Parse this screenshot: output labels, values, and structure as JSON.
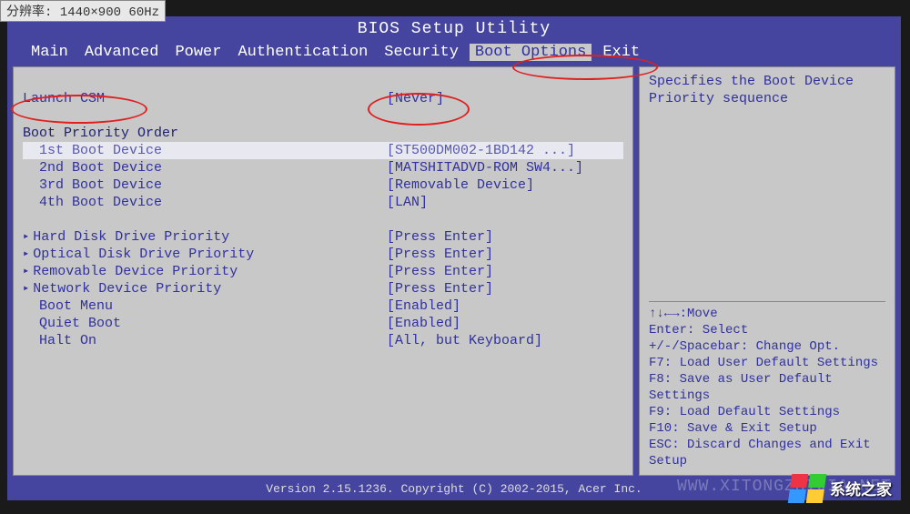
{
  "monitor_info": "分辨率: 1440×900 60Hz",
  "title": "BIOS Setup Utility",
  "menu": {
    "items": [
      {
        "label": "Main"
      },
      {
        "label": "Advanced"
      },
      {
        "label": "Power"
      },
      {
        "label": "Authentication"
      },
      {
        "label": "Security"
      },
      {
        "label": "Boot Options"
      },
      {
        "label": "Exit"
      }
    ],
    "active_index": 5
  },
  "settings": {
    "launch_csm": {
      "label": "Launch CSM",
      "value": "[Never]"
    },
    "boot_order_header": "Boot Priority Order",
    "boot_devices": [
      {
        "label": "  1st Boot Device",
        "value": "[ST500DM002-1BD142  ...]",
        "selected": true
      },
      {
        "label": "  2nd Boot Device",
        "value": "[MATSHITADVD-ROM SW4...]"
      },
      {
        "label": "  3rd Boot Device",
        "value": "[Removable Device]"
      },
      {
        "label": "  4th Boot Device",
        "value": "[LAN]"
      }
    ],
    "priorities": [
      {
        "label": "Hard Disk Drive Priority",
        "value": "[Press Enter]"
      },
      {
        "label": "Optical Disk Drive Priority",
        "value": "[Press Enter]"
      },
      {
        "label": "Removable Device Priority",
        "value": "[Press Enter]"
      },
      {
        "label": "Network Device Priority",
        "value": "[Press Enter]"
      }
    ],
    "options": [
      {
        "label": "  Boot Menu",
        "value": "[Enabled]"
      },
      {
        "label": "  Quiet Boot",
        "value": "[Enabled]"
      },
      {
        "label": "  Halt On",
        "value": "[All, but Keyboard]"
      }
    ]
  },
  "help": {
    "description_line1": "Specifies the Boot Device",
    "description_line2": "Priority sequence",
    "keys": [
      "↑↓←→:Move",
      "Enter: Select",
      "+/-/Spacebar: Change Opt.",
      "F7: Load User Default Settings",
      "F8: Save as User Default",
      "Settings",
      "F9: Load Default Settings",
      "F10: Save & Exit Setup",
      "ESC: Discard Changes and Exit",
      "Setup"
    ]
  },
  "footer": "Version 2.15.1236. Copyright (C) 2002-2015, Acer Inc.",
  "watermark": "WWW.XITONGZHIJIA.NET",
  "logo_text": "系统之家"
}
